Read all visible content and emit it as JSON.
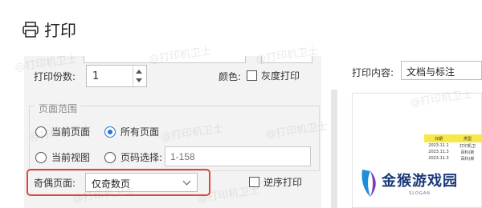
{
  "dialog": {
    "title": "打印"
  },
  "copies": {
    "label": "打印份数:",
    "value": "1"
  },
  "color": {
    "label": "颜色:",
    "grayscale_label": "灰度打印",
    "grayscale_checked": false
  },
  "page_range": {
    "title": "页面范围",
    "options": [
      {
        "label": "当前页面",
        "selected": false
      },
      {
        "label": "所有页面",
        "selected": true
      },
      {
        "label": "当前视图",
        "selected": false
      },
      {
        "label": "页码选择:",
        "selected": false
      }
    ],
    "pages_placeholder": "1-158"
  },
  "odd_even": {
    "label": "奇偶页面:",
    "value": "仅奇数页"
  },
  "reverse_print": {
    "label": "逆序打印",
    "checked": false
  },
  "print_content": {
    "label": "打印内容:",
    "value": "文档与标注"
  },
  "preview": {
    "headers": [
      "日期",
      "类型"
    ],
    "rows": [
      [
        "2023.11.1",
        "打印机卫"
      ],
      [
        "2023.11.3",
        "百科(新"
      ],
      [
        "2023.11.3",
        "百科(新"
      ]
    ]
  },
  "watermark": {
    "text": "@打印机卫士"
  },
  "logo": {
    "text": "金猴游戏园",
    "sub": "SLOGAN"
  },
  "colors": {
    "accent": "#2a73d8",
    "highlight_border": "#e0453e",
    "preview_header": "#f7e84a",
    "logo": "#1b3a7a"
  },
  "icons": {
    "title": "printer-icon",
    "spin_up": "chevron-up-icon",
    "spin_down": "chevron-down-icon",
    "select": "chevron-down-icon"
  }
}
